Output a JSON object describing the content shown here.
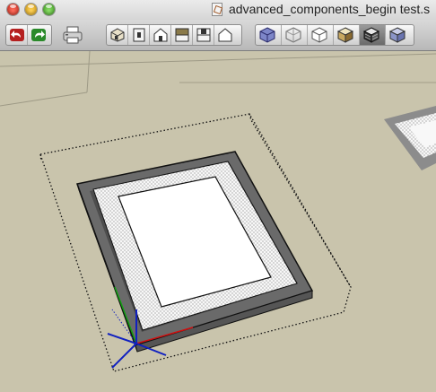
{
  "window": {
    "title": "advanced_components_begin test.s",
    "traffic_lights": [
      "close",
      "minimize",
      "zoom"
    ]
  },
  "toolbar": {
    "undo_icon": "undo-arrow-icon",
    "redo_icon": "redo-arrow-icon",
    "print_icon": "printer-icon",
    "standard_views": [
      "iso-view-icon",
      "top-view-icon",
      "front-view-icon",
      "right-view-icon",
      "back-view-icon",
      "left-view-icon"
    ],
    "face_styles": [
      "xray-style-icon",
      "wireframe-style-icon",
      "hidden-line-style-icon",
      "shaded-style-icon",
      "shaded-textures-style-icon",
      "monochrome-style-icon"
    ]
  },
  "colors": {
    "ground": "#c9c4ac",
    "axis_red": "#d01010",
    "axis_green": "#10a010",
    "axis_blue": "#1020c0",
    "frame_dark": "#6a6a6a",
    "mat": "#f2f2f2"
  }
}
